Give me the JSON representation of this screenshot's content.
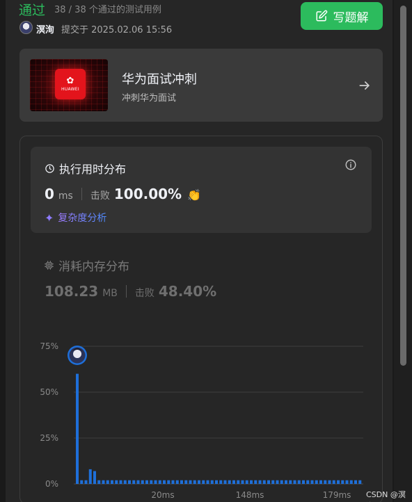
{
  "header": {
    "status": "通过",
    "testcases": "38 / 38 个通过的测试用例",
    "author": "溟洵",
    "submitted": "提交于 2025.02.06 15:56",
    "solution_button": "写题解"
  },
  "promo": {
    "logo_text": "HUAWEI",
    "title": "华为面试冲刺",
    "subtitle": "冲刺华为面试"
  },
  "runtime": {
    "title": "执行用时分布",
    "value": "0",
    "unit": "ms",
    "beats_label": "击败",
    "beats_value": "100.00%",
    "complexity": "复杂度分析"
  },
  "memory": {
    "title": "消耗内存分布",
    "value": "108.23",
    "unit": "MB",
    "beats_label": "击败",
    "beats_value": "48.40%"
  },
  "chart_data": {
    "type": "bar",
    "y_ticks": [
      "75%",
      "50%",
      "25%",
      "0%"
    ],
    "ylim": [
      0,
      75
    ],
    "x_ticks": [
      "20ms",
      "148ms",
      "179ms"
    ],
    "highlight_index": 0,
    "values": [
      60,
      2,
      2,
      8,
      7,
      2,
      2,
      2,
      2,
      2,
      2,
      2,
      2,
      2,
      2,
      2,
      2,
      2,
      2,
      2,
      2,
      2,
      2,
      2,
      2,
      2,
      2,
      2,
      2,
      2,
      2,
      2,
      2,
      2,
      2,
      2,
      2,
      2,
      2,
      2,
      2,
      2,
      2,
      2,
      2,
      2,
      2,
      2,
      2,
      2,
      2,
      2,
      2,
      2,
      2,
      2,
      2,
      2,
      2,
      2,
      2,
      2,
      2,
      2,
      2,
      2
    ],
    "colors": {
      "bar": "#1e6fd9",
      "grid": "#3d3d3d",
      "axis": "#4a4a4a",
      "tick": "#8a8a8a"
    }
  },
  "watermark": "CSDN @溟洵"
}
